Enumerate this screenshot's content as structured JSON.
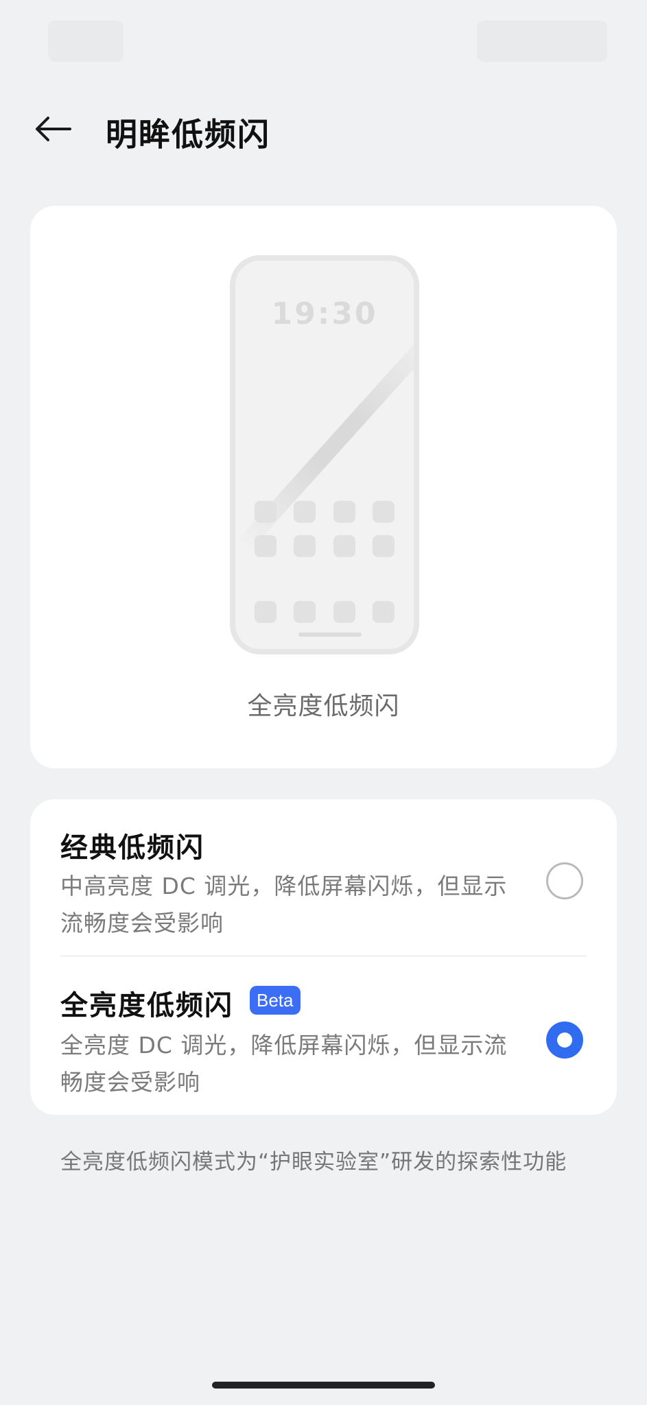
{
  "header": {
    "title": "明眸低频闪",
    "back_icon": "back-arrow-icon"
  },
  "preview": {
    "phone_time": "19:30",
    "caption": "全亮度低频闪"
  },
  "options": [
    {
      "title": "经典低频闪",
      "description": "中高亮度 DC 调光，降低屏幕闪烁，但显示流畅度会受影响",
      "selected": false
    },
    {
      "title": "全亮度低频闪",
      "badge": "Beta",
      "description": "全亮度 DC 调光，降低屏幕闪烁，但显示流畅度会受影响",
      "selected": true
    }
  ],
  "footnote": "全亮度低频闪模式为“护眼实验室”研发的探索性功能",
  "colors": {
    "accent": "#2f6cf0",
    "background": "#f0f1f3",
    "card": "#ffffff"
  }
}
